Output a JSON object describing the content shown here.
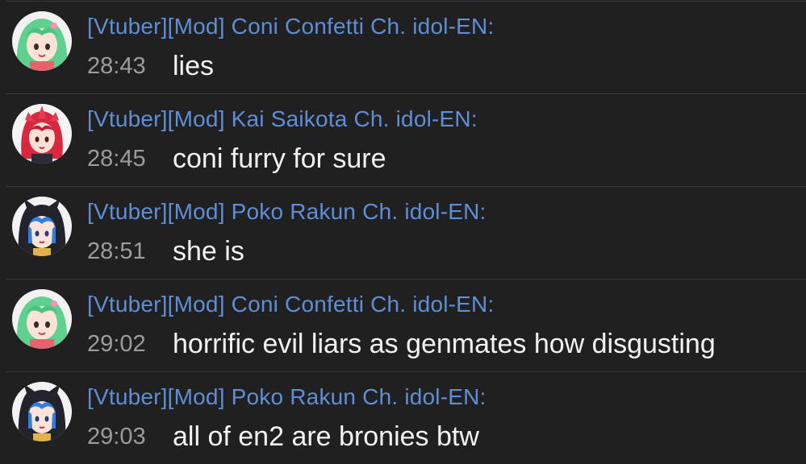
{
  "chat": {
    "messages": [
      {
        "author": "[Vtuber][Mod] Coni Confetti Ch. idol-EN:",
        "time": "28:43",
        "text": "lies",
        "avatar_icon": "coni-confetti-avatar"
      },
      {
        "author": "[Vtuber][Mod] Kai Saikota Ch. idol-EN:",
        "time": "28:45",
        "text": "coni furry for sure",
        "avatar_icon": "kai-saikota-avatar"
      },
      {
        "author": "[Vtuber][Mod] Poko Rakun Ch. idol-EN:",
        "time": "28:51",
        "text": "she is",
        "avatar_icon": "poko-rakun-avatar"
      },
      {
        "author": "[Vtuber][Mod] Coni Confetti Ch. idol-EN:",
        "time": "29:02",
        "text": "horrific evil liars as genmates how disgusting",
        "avatar_icon": "coni-confetti-avatar"
      },
      {
        "author": "[Vtuber][Mod] Poko Rakun Ch. idol-EN:",
        "time": "29:03",
        "text": "all of en2 are bronies btw",
        "avatar_icon": "poko-rakun-avatar"
      }
    ]
  },
  "colors": {
    "background": "#202020",
    "author": "#5f8ed6",
    "timestamp": "#9c9c9c",
    "message_text": "#f2f2f2",
    "divider": "#3a3a3a"
  }
}
